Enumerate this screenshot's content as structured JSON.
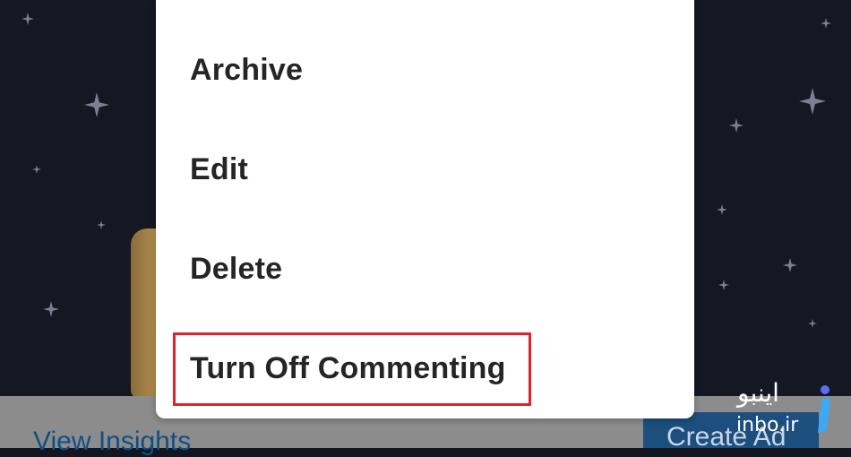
{
  "menu": {
    "items": [
      {
        "label": "Archive"
      },
      {
        "label": "Edit"
      },
      {
        "label": "Delete"
      },
      {
        "label": "Turn Off Commenting",
        "highlighted": true
      }
    ]
  },
  "bottom": {
    "view_insights": "View Insights",
    "create_ad": "Create Ad"
  },
  "watermark": {
    "persian": "اینبو",
    "domain": "inbo.ir"
  },
  "colors": {
    "background": "#151722",
    "menu_bg": "#ffffff",
    "highlight": "#e0232a",
    "bottom_bar": "#8c8c8c",
    "link": "#0f4f84",
    "button": "#1d4f7e"
  }
}
